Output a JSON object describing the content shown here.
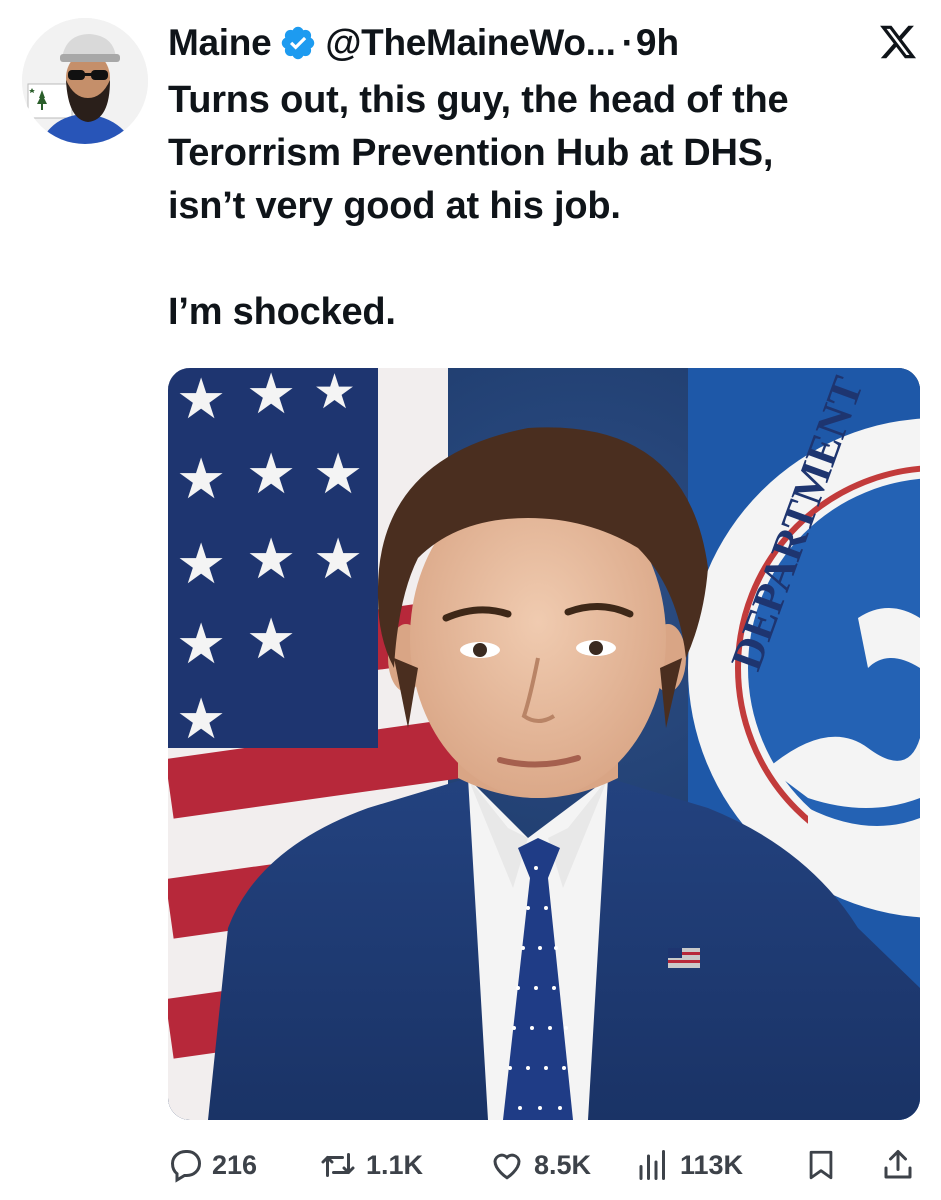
{
  "tweet": {
    "author_name": "Maine",
    "verified": true,
    "handle": "@TheMaineWo...",
    "separator": "·",
    "time": "9h",
    "platform_icon": "x-logo-icon",
    "text_lines": [
      "Turns out, this guy, the head of the",
      "Terorrism Prevention Hub at DHS,",
      "isn’t very good at his job."
    ],
    "text_final": "I’m shocked.",
    "media_type": "photo"
  },
  "stats": {
    "replies": "216",
    "retweets": "1.1K",
    "likes": "8.5K",
    "views": "113K"
  },
  "icons": {
    "reply": "speech-bubble-icon",
    "retweet": "retweet-arrows-icon",
    "like": "heart-icon",
    "views": "bar-chart-icon",
    "bookmark": "bookmark-icon",
    "share": "share-upload-icon"
  },
  "colors": {
    "verified_blue": "#1d9bf0",
    "text": "#0f1419",
    "icon_gray": "#3d4249"
  }
}
